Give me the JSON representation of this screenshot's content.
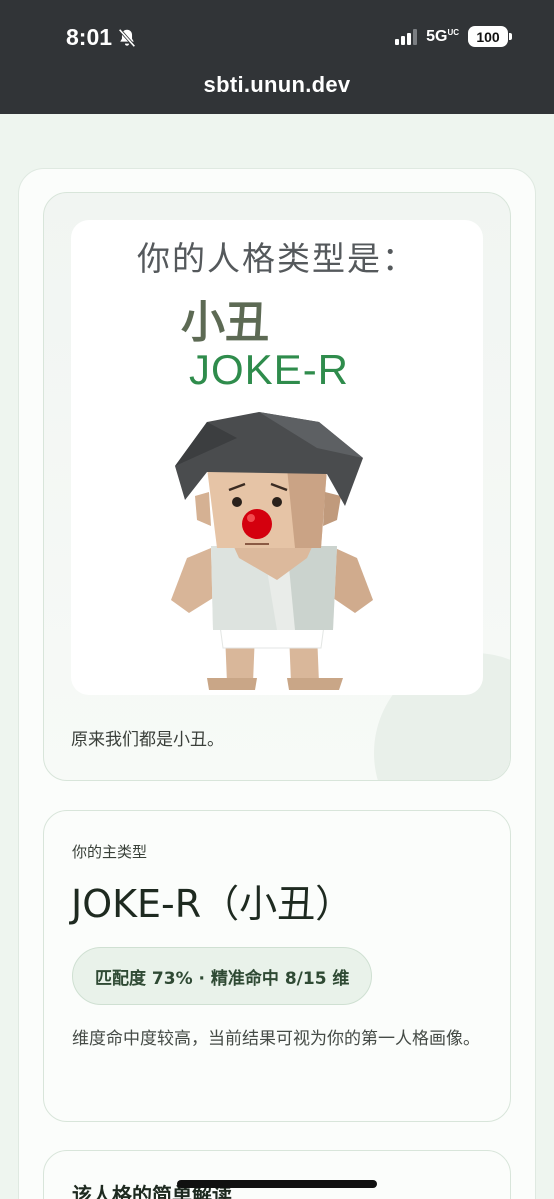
{
  "status_bar": {
    "time": "8:01",
    "network": "5G",
    "network_suffix": "UC",
    "battery": "100"
  },
  "browser": {
    "url": "sbti.unun.dev"
  },
  "result_card": {
    "image": {
      "heading": "你的人格类型是：",
      "type_cn": "小丑",
      "type_code": "JOKE-R"
    },
    "caption": "原来我们都是小丑。"
  },
  "main_type_card": {
    "label": "你的主类型",
    "title": "JOKE-R（小丑）",
    "match_pill": "匹配度 73% · 精准命中 8/15 维",
    "description": "维度命中度较高，当前结果可视为你的第一人格画像。"
  },
  "interpretation_card": {
    "title": "该人格的简单解读"
  },
  "colors": {
    "top_bar": "#313437",
    "accent_green": "#2f8c4c",
    "page_bg": "#eef5ef"
  }
}
